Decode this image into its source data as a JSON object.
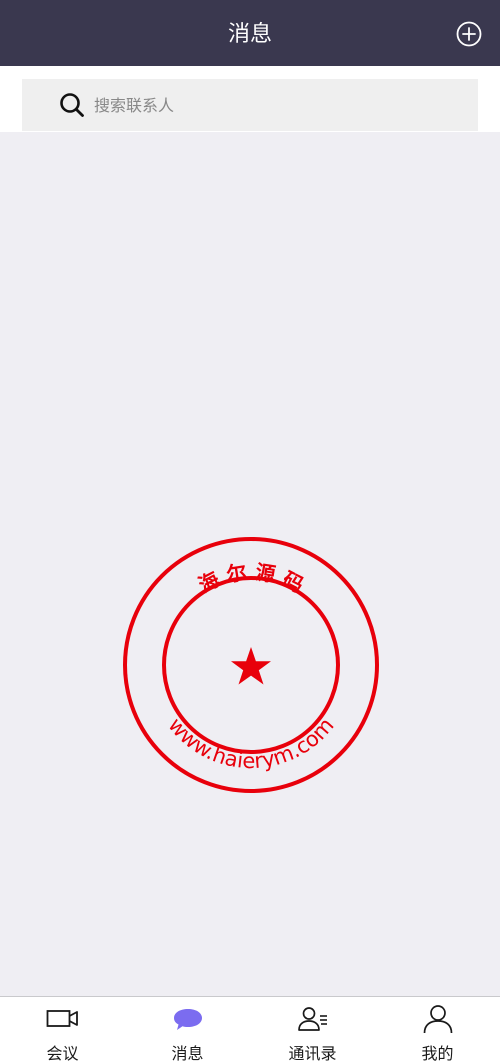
{
  "header": {
    "title": "消息",
    "add_icon": "plus-circle-icon"
  },
  "search": {
    "icon": "search-icon",
    "placeholder": "搜索联系人",
    "value": ""
  },
  "watermark": {
    "top_text": "海 尔 源 码",
    "bottom_text": "www.haierym.com",
    "color": "#e8000b",
    "center_icon": "star-icon"
  },
  "tabs": [
    {
      "label": "会议",
      "icon": "video-camera-icon",
      "active": false
    },
    {
      "label": "消息",
      "icon": "chat-bubble-icon",
      "active": true
    },
    {
      "label": "通讯录",
      "icon": "contacts-icon",
      "active": false
    },
    {
      "label": "我的",
      "icon": "user-icon",
      "active": false
    }
  ],
  "colors": {
    "header_bg": "#3a384f",
    "page_bg": "#efeef3",
    "active_tab_icon": "#7b6cf0"
  }
}
